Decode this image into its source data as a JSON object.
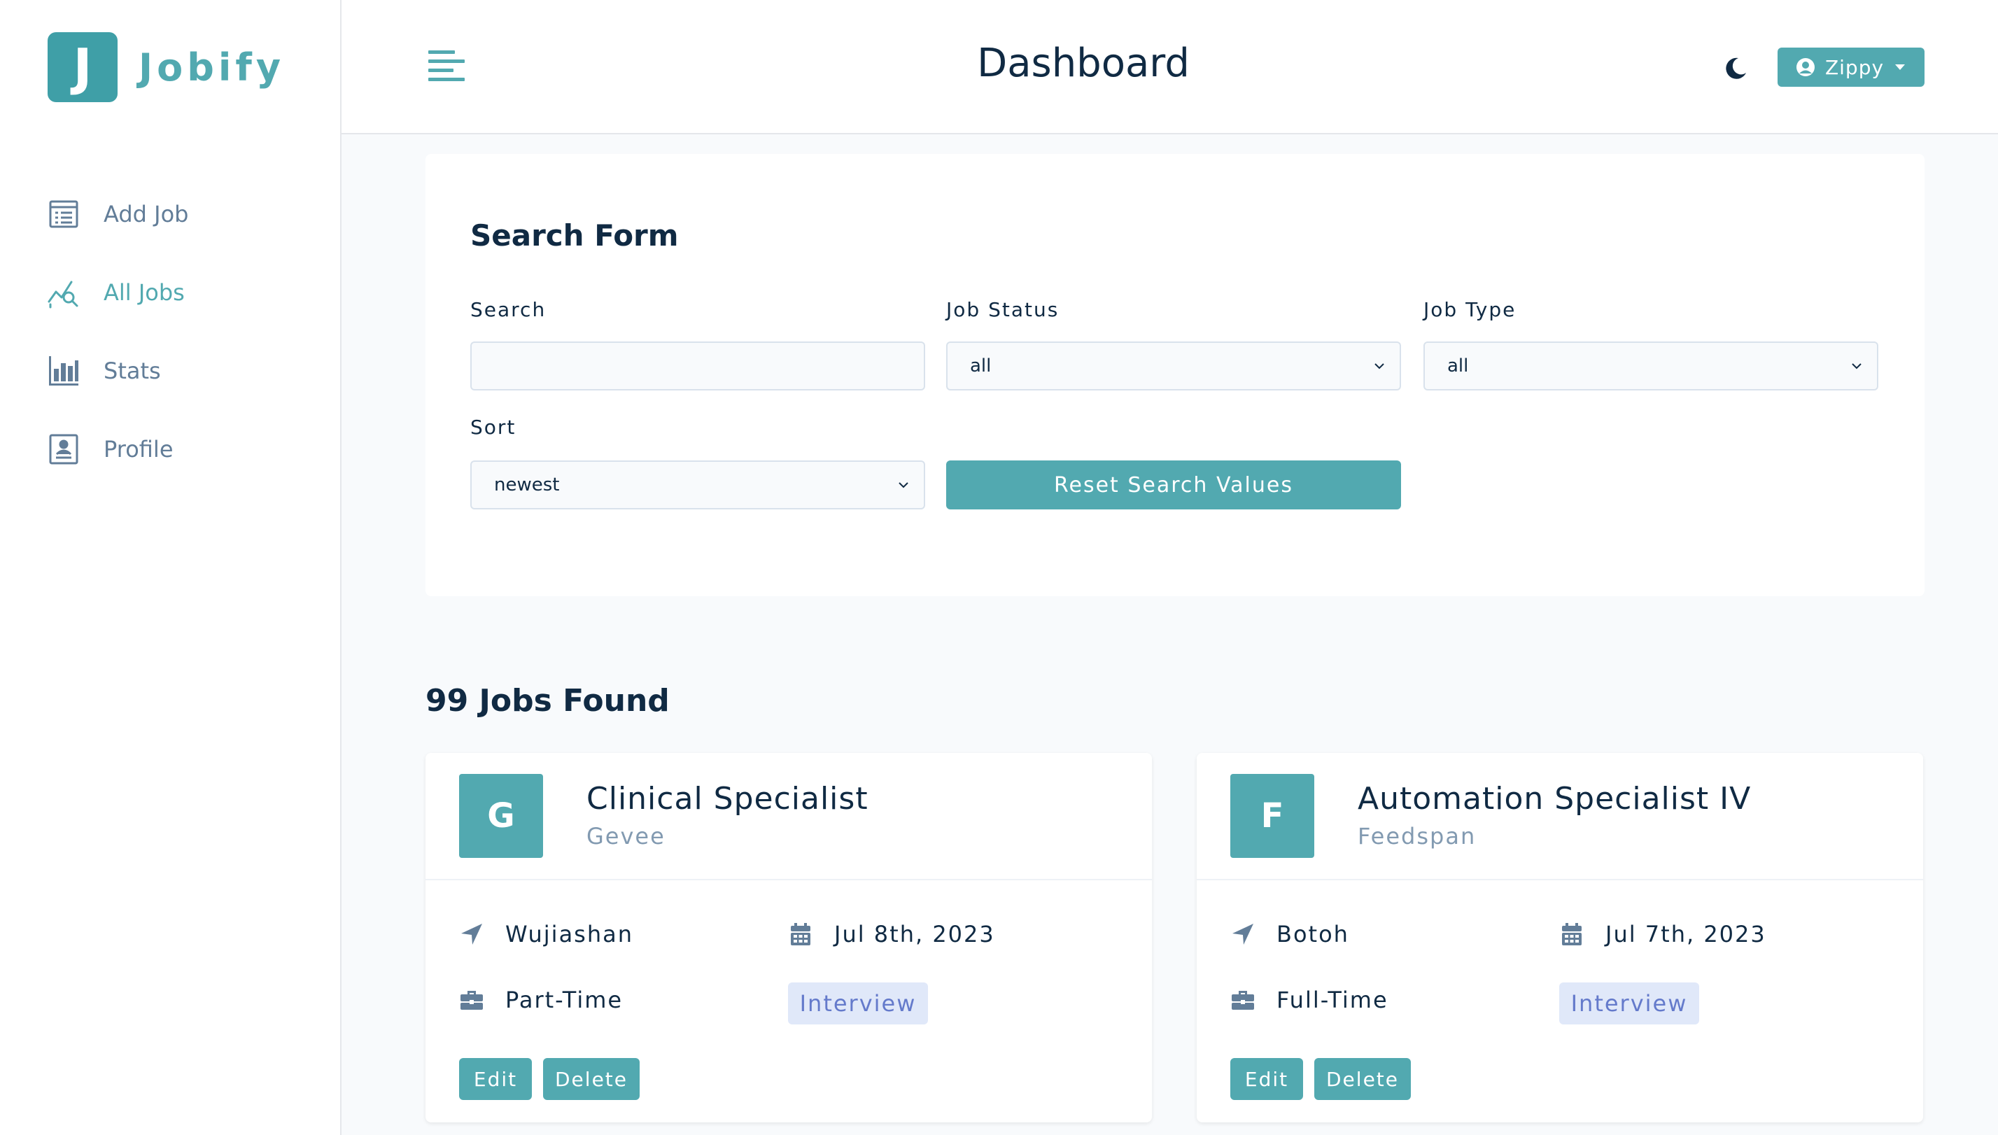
{
  "brand": {
    "letter": "J",
    "name": "Jobify"
  },
  "sidebar": {
    "items": [
      {
        "label": "Add Job",
        "icon": "add-job-icon",
        "active": false
      },
      {
        "label": "All Jobs",
        "icon": "all-jobs-icon",
        "active": true
      },
      {
        "label": "Stats",
        "icon": "stats-icon",
        "active": false
      },
      {
        "label": "Profile",
        "icon": "profile-icon",
        "active": false
      }
    ]
  },
  "header": {
    "title": "Dashboard",
    "user_name": "Zippy"
  },
  "search_form": {
    "title": "Search Form",
    "search_label": "Search",
    "search_value": "",
    "job_status_label": "Job Status",
    "job_status_value": "all",
    "job_type_label": "Job Type",
    "job_type_value": "all",
    "sort_label": "Sort",
    "sort_value": "newest",
    "reset_label": "Reset Search Values"
  },
  "jobs": {
    "count_text": "99 Jobs Found",
    "items": [
      {
        "initial": "G",
        "position": "Clinical Specialist",
        "company": "Gevee",
        "location": "Wujiashan",
        "date": "Jul 8th, 2023",
        "job_type": "Part-Time",
        "status": "Interview",
        "edit_label": "Edit",
        "delete_label": "Delete"
      },
      {
        "initial": "F",
        "position": "Automation Specialist IV",
        "company": "Feedspan",
        "location": "Botoh",
        "date": "Jul 7th, 2023",
        "job_type": "Full-Time",
        "status": "Interview",
        "edit_label": "Edit",
        "delete_label": "Delete"
      }
    ]
  },
  "colors": {
    "primary": "#52a9b0",
    "logo_bg": "#3f9fa7",
    "text_dark": "#102a43",
    "text_muted": "#627d98",
    "status_bg": "#e0e8f9",
    "status_text": "#647acb"
  }
}
